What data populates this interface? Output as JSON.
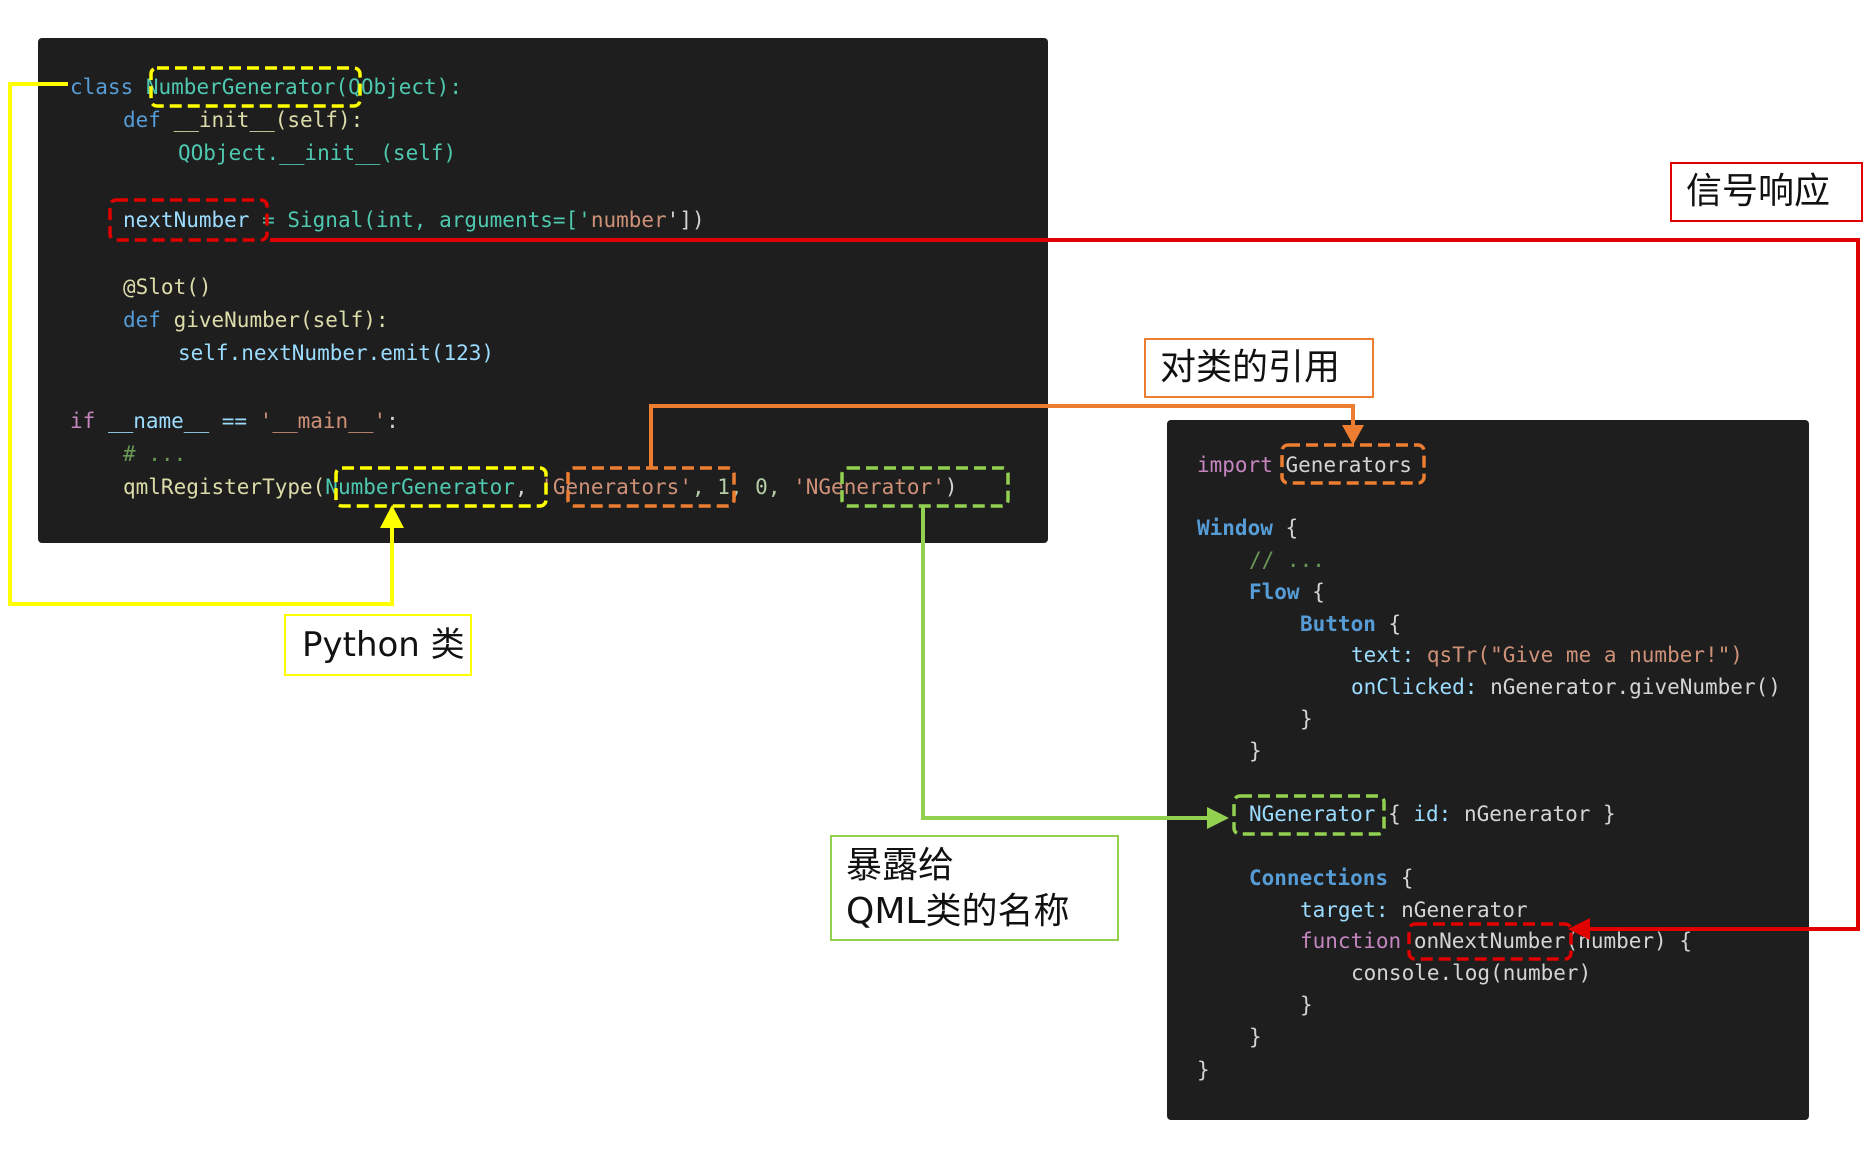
{
  "python_code": {
    "line1": {
      "kw": "class",
      "name": "NumberGenerator",
      "rest": "(QObject):"
    },
    "line2": {
      "kw": "def",
      "rest": "__init__(self):"
    },
    "line3": {
      "rest": "QObject.__init__(self)"
    },
    "line4": {
      "name": "nextNumber",
      "rest1": " = Signal(int, arguments=['",
      "str": "number",
      "rest2": "'])"
    },
    "line5": {
      "rest": "@Slot()"
    },
    "line6": {
      "kw": "def",
      "rest": "giveNumber(self):"
    },
    "line7": {
      "rest": "self.nextNumber.emit(123)"
    },
    "line8": {
      "kw": "if",
      "rest1": "__name__ == ",
      "str": "'__main__'",
      "rest2": ":"
    },
    "line9": {
      "cmt": "# ..."
    },
    "line10": {
      "fn": "qmlRegisterType(",
      "a1": "NumberGenerator",
      "c1": ", ",
      "a2": "'Generators'",
      "c2": ", 1, 0, ",
      "a3": "'NGenerator'",
      "end": ")"
    }
  },
  "qml_code": {
    "l1": {
      "kw": "import",
      "mod": "Generators"
    },
    "l2": {
      "type": "Window",
      "rest": " {"
    },
    "l3": {
      "cmt": "// ..."
    },
    "l4": {
      "type": "Flow",
      "rest": " {"
    },
    "l5": {
      "type": "Button",
      "rest": " {"
    },
    "l6": {
      "prop": "text:",
      "rest": " qsTr(\"Give me a number!\")"
    },
    "l7": {
      "prop": "onClicked:",
      "rest": " nGenerator.giveNumber()"
    },
    "l8": {
      "rest": "}"
    },
    "l9": {
      "rest": "}"
    },
    "l10": {
      "type": "NGenerator",
      "rest1": " { ",
      "prop": "id:",
      "rest2": " nGenerator }"
    },
    "l11": {
      "type": "Connections",
      "rest": " {"
    },
    "l12": {
      "prop": "target:",
      "rest": " nGenerator"
    },
    "l13": {
      "kw": "function",
      "name": "onNextNumber",
      "rest": "(number) {"
    },
    "l14": {
      "rest": "console.log(number)"
    },
    "l15": {
      "rest": "}"
    },
    "l16": {
      "rest": "}"
    },
    "l17": {
      "rest": "}"
    }
  },
  "labels": {
    "python_class": "Python 类",
    "class_ref": "对类的引用",
    "signal_resp": "信号响应",
    "qml_name_1": "暴露给",
    "qml_name_2": "QML类的名称"
  },
  "colors": {
    "yellow": "#ffff00",
    "orange": "#ed7d31",
    "green": "#92d050",
    "red": "#e00000"
  }
}
